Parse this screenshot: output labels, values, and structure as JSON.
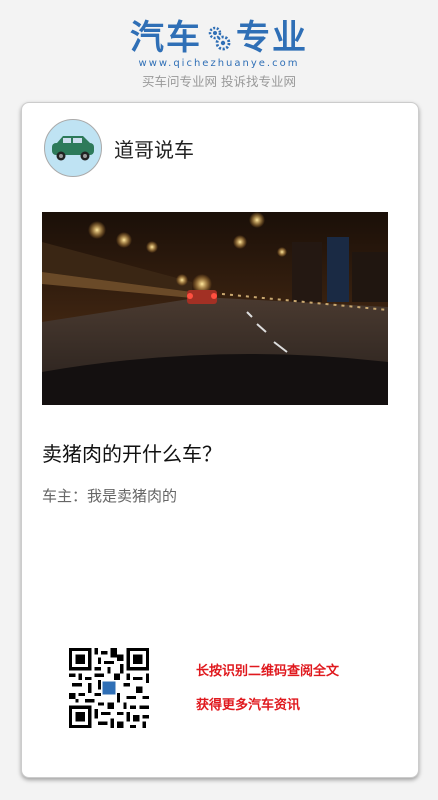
{
  "brand": {
    "title_left": "汽车",
    "title_right": "专业",
    "url": "www.qichezhuanye.com",
    "slogan": "买车问专业网 投诉找专业网",
    "accent_color": "#2f6fb6",
    "gear_icon": "gear-icon"
  },
  "author": {
    "name": "道哥说车",
    "avatar_icon": "car-avatar-icon"
  },
  "article": {
    "image_desc_icon": "night-road-photo",
    "title": "卖猪肉的开什么车？",
    "subtitle": "车主：我是卖猪肉的"
  },
  "footer": {
    "qr_icon": "qr-code-icon",
    "tip_line1": "长按识别二维码查阅全文",
    "tip_line2": "获得更多汽车资讯",
    "tip_color": "#e0191e"
  }
}
